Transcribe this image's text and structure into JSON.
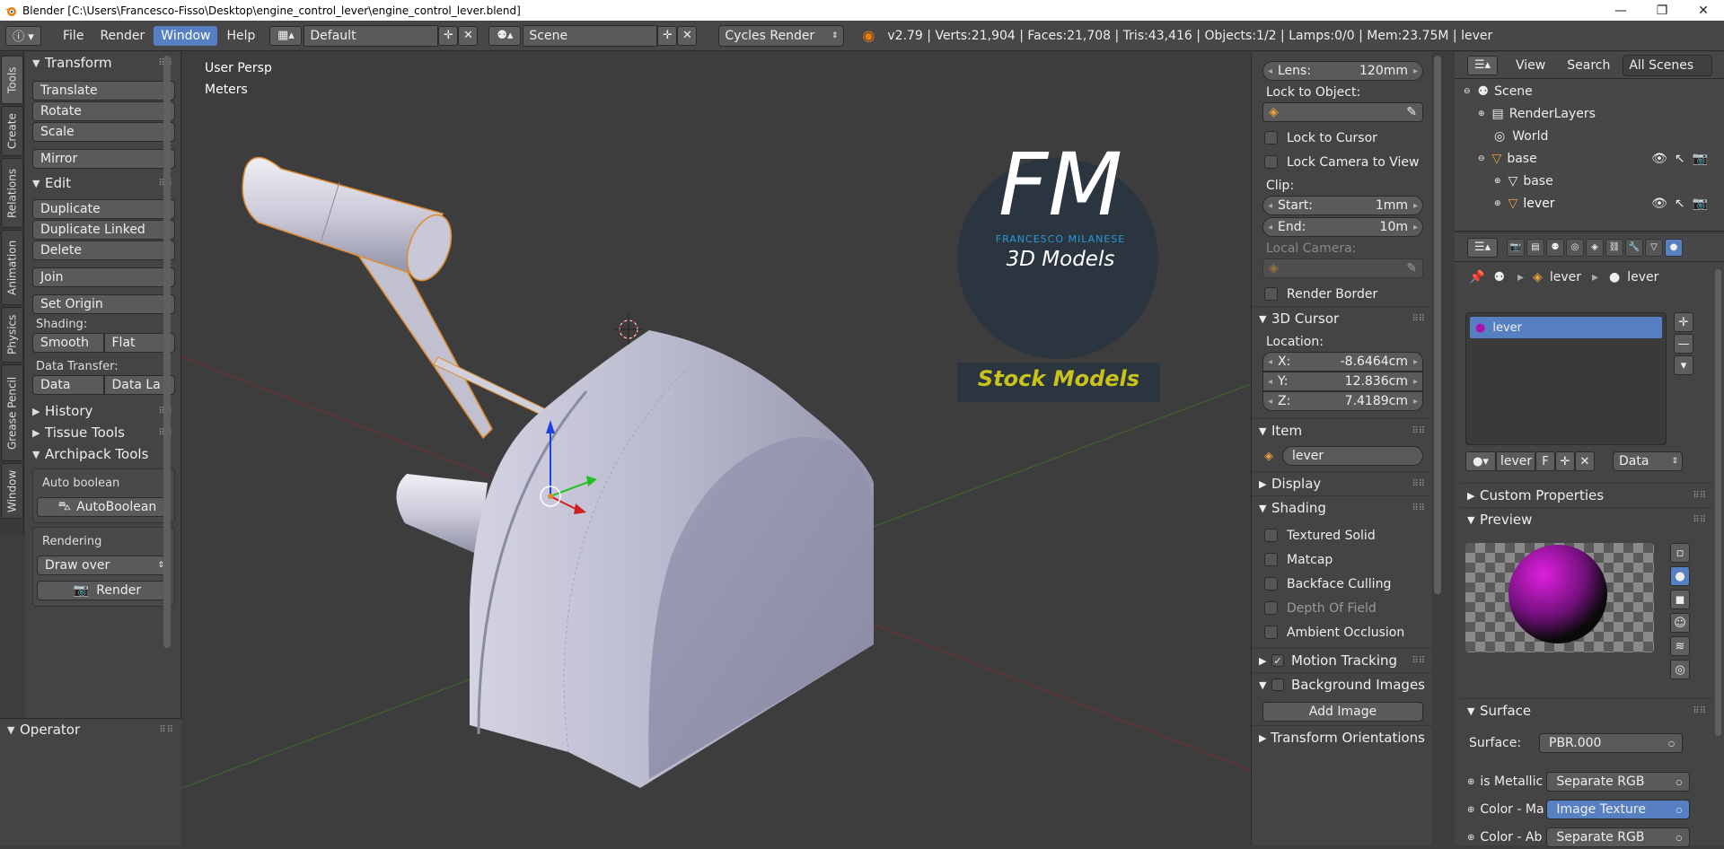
{
  "window": {
    "title": "Blender [C:\\Users\\Francesco-Fisso\\Desktop\\engine_control_lever\\engine_control_lever.blend]",
    "controls": [
      "—",
      "❐",
      "✕"
    ]
  },
  "menubar": {
    "items": [
      "File",
      "Render",
      "Window",
      "Help"
    ],
    "layout": "Default",
    "scene": "Scene",
    "engine": "Cycles Render",
    "stats": "v2.79 | Verts:21,904 | Faces:21,708 | Tris:43,416 | Objects:1/2 | Lamps:0/0 | Mem:23.75M | lever"
  },
  "left_tabs": [
    "Tools",
    "Create",
    "Relations",
    "Animation",
    "Physics",
    "Grease Pencil",
    "Window"
  ],
  "tools": {
    "transform_title": "Transform",
    "translate": "Translate",
    "rotate": "Rotate",
    "scale": "Scale",
    "mirror": "Mirror",
    "edit_title": "Edit",
    "duplicate": "Duplicate",
    "duplicate_linked": "Duplicate Linked",
    "delete": "Delete",
    "join": "Join",
    "set_origin": "Set Origin",
    "shading_label": "Shading:",
    "smooth": "Smooth",
    "flat": "Flat",
    "data_transfer_label": "Data Transfer:",
    "data": "Data",
    "data_la": "Data La",
    "history": "History",
    "tissue_tools": "Tissue Tools",
    "archipack": "Archipack Tools",
    "auto_boolean_label": "Auto boolean",
    "auto_boolean_btn": "AutoBoolean",
    "rendering_label": "Rendering",
    "draw_over": "Draw over",
    "render_btn": "Render",
    "operator": "Operator"
  },
  "viewport": {
    "view_label": "User Persp",
    "units_label": "Meters",
    "watermark_fm": "FM",
    "watermark_name": "FRANCESCO MILANESE",
    "watermark_3d": "3D Models",
    "watermark_stock": "Stock Models"
  },
  "view_props": {
    "lens_label": "Lens:",
    "lens_value": "120mm",
    "lock_to_object": "Lock to Object:",
    "lock_to_cursor": "Lock to Cursor",
    "lock_camera": "Lock Camera to View",
    "clip_label": "Clip:",
    "start_label": "Start:",
    "start_value": "1mm",
    "end_label": "End:",
    "end_value": "10m",
    "local_camera": "Local Camera:",
    "render_border": "Render Border",
    "cursor_title": "3D Cursor",
    "location_label": "Location:",
    "x_label": "X:",
    "x_value": "-8.6464cm",
    "y_label": "Y:",
    "y_value": "12.836cm",
    "z_label": "Z:",
    "z_value": "7.4189cm",
    "item_title": "Item",
    "item_name": "lever",
    "display_title": "Display",
    "shading_title": "Shading",
    "textured_solid": "Textured Solid",
    "matcap": "Matcap",
    "backface_culling": "Backface Culling",
    "depth_of_field": "Depth Of Field",
    "ambient_occlusion": "Ambient Occlusion",
    "motion_tracking": "Motion Tracking",
    "background_images": "Background Images",
    "add_image": "Add Image",
    "transform_orientations": "Transform Orientations"
  },
  "outliner": {
    "view": "View",
    "search": "Search",
    "filter": "All Scenes",
    "rows": [
      "Scene",
      "RenderLayers",
      "World",
      "base",
      "base",
      "lever"
    ]
  },
  "material": {
    "breadcrumb_obj": "lever",
    "breadcrumb_mat": "lever",
    "slot": "lever",
    "mat_name": "lever",
    "f_label": "F",
    "link": "Data",
    "custom_props": "Custom Properties",
    "preview": "Preview",
    "surface_title": "Surface",
    "surface_label": "Surface:",
    "surface_value": "PBR.000",
    "sockets": [
      {
        "name": "is Metallic",
        "value": "Separate RGB"
      },
      {
        "name": "Color - Ma",
        "value": "Image Texture"
      },
      {
        "name": "Color - Ab",
        "value": "Separate RGB"
      }
    ]
  },
  "colors": {
    "accent": "#5680c2",
    "panel": "#444444",
    "viewport": "#3d3d3d",
    "watermark_blue": "#2a9ad6",
    "watermark_gold": "#c8c21a"
  }
}
